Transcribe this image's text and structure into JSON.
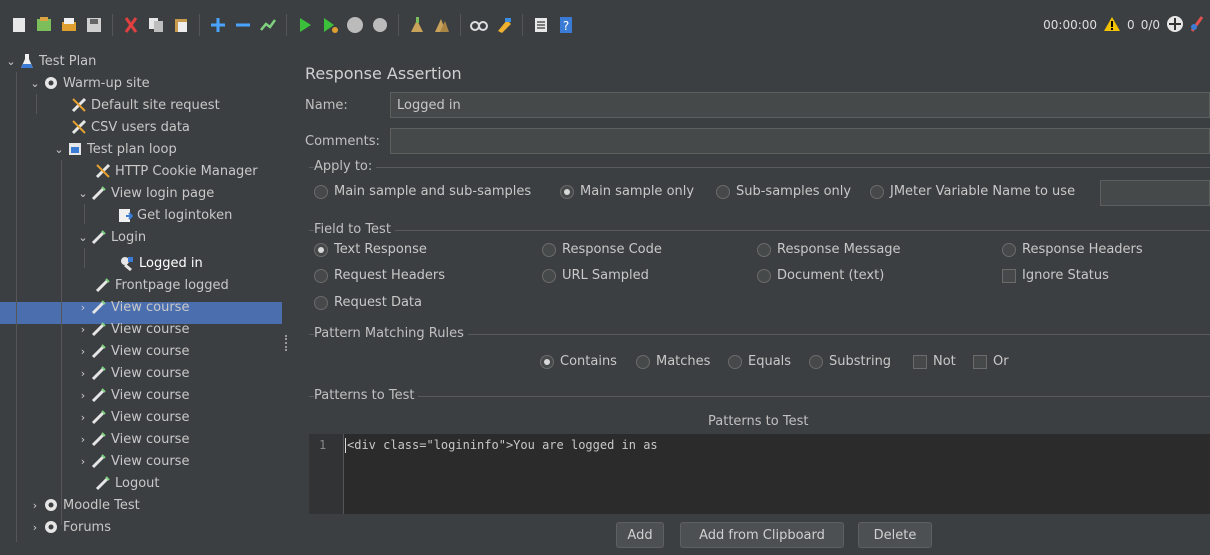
{
  "toolbar": {
    "timer": "00:00:00",
    "warning_count": "0",
    "threads": "0/0",
    "icons": [
      "new-icon",
      "templates-icon",
      "open-icon",
      "save-icon",
      "cut-icon",
      "copy-icon",
      "paste-icon",
      "expand-icon",
      "collapse-icon",
      "toggle-icon",
      "start-icon",
      "start-no-pause-icon",
      "stop-icon",
      "shutdown-icon",
      "clear-icon",
      "clear-all-icon",
      "search-icon",
      "reset-search-icon",
      "function-helper-icon",
      "help-icon"
    ]
  },
  "tree": {
    "items": [
      {
        "label": "Test Plan"
      },
      {
        "label": "Warm-up site"
      },
      {
        "label": "Default site request"
      },
      {
        "label": "CSV users data"
      },
      {
        "label": "Test plan loop"
      },
      {
        "label": "HTTP Cookie Manager"
      },
      {
        "label": "View login page"
      },
      {
        "label": "Get logintoken"
      },
      {
        "label": "Login"
      },
      {
        "label": "Logged in"
      },
      {
        "label": "Frontpage logged"
      },
      {
        "label": "View course"
      },
      {
        "label": "View course"
      },
      {
        "label": "View course"
      },
      {
        "label": "View course"
      },
      {
        "label": "View course"
      },
      {
        "label": "View course"
      },
      {
        "label": "View course"
      },
      {
        "label": "View course"
      },
      {
        "label": "Logout"
      },
      {
        "label": "Moodle Test"
      },
      {
        "label": "Forums"
      }
    ]
  },
  "panel": {
    "title": "Response Assertion",
    "name_label": "Name:",
    "name_value": "Logged in",
    "comments_label": "Comments:",
    "comments_value": "",
    "apply_to": {
      "title": "Apply to:",
      "options": [
        "Main sample and sub-samples",
        "Main sample only",
        "Sub-samples only",
        "JMeter Variable Name to use"
      ],
      "selected": "Main sample only",
      "variable_value": ""
    },
    "field_to_test": {
      "title": "Field to Test",
      "options": [
        "Text Response",
        "Response Code",
        "Response Message",
        "Response Headers",
        "Request Headers",
        "URL Sampled",
        "Document (text)",
        "Ignore Status",
        "Request Data"
      ],
      "selected": "Text Response"
    },
    "pattern_matching": {
      "title": "Pattern Matching Rules",
      "options": [
        "Contains",
        "Matches",
        "Equals",
        "Substring",
        "Not",
        "Or"
      ],
      "selected": "Contains"
    },
    "patterns": {
      "group_title": "Patterns to Test",
      "table_header": "Patterns to Test",
      "line_number": "1",
      "line": "<div class=\"logininfo\">You are logged in as"
    },
    "buttons": {
      "add": "Add",
      "add_clipboard": "Add from Clipboard",
      "delete": "Delete"
    }
  }
}
